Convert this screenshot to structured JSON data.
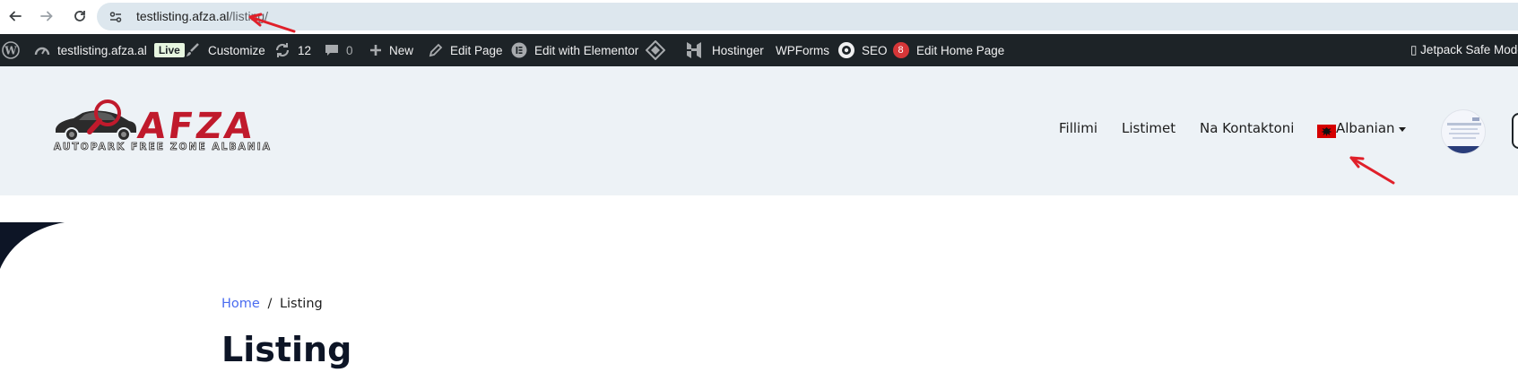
{
  "browser": {
    "url_host": "testlisting.afza.al",
    "url_path": "/listing/"
  },
  "admin_bar": {
    "site_name": "testlisting.afza.al",
    "live_badge": "Live",
    "customize": "Customize",
    "updates_count": "12",
    "comments_count": "0",
    "new": "New",
    "edit_page": "Edit Page",
    "edit_elementor": "Edit with Elementor",
    "hostinger": "Hostinger",
    "wpforms": "WPForms",
    "seo": "SEO",
    "seo_count": "8",
    "edit_home": "Edit Home Page",
    "jetpack": "▯ Jetpack Safe Mode"
  },
  "header": {
    "logo_word": "AFZA",
    "logo_tagline": "AUTOPARK FREE ZONE ALBANIA",
    "nav": [
      "Fillimi",
      "Listimet",
      "Na Kontaktoni"
    ],
    "language": "Albanian"
  },
  "content": {
    "breadcrumb_home": "Home",
    "breadcrumb_sep": "/",
    "breadcrumb_current": "Listing",
    "title": "Listing"
  },
  "colors": {
    "accent_red": "#c01a2c",
    "admin_bar_bg": "#1d2327",
    "header_bg": "#edf2f6",
    "link_blue": "#4a6cf0"
  },
  "icons": [
    "back-icon",
    "forward-icon",
    "reload-icon",
    "site-info-icon",
    "wordpress-icon",
    "dashboard-icon",
    "brush-icon",
    "updates-icon",
    "comment-icon",
    "plus-icon",
    "pencil-icon",
    "elementor-icon",
    "diamond-icon",
    "hostinger-icon",
    "seo-gear-icon",
    "albania-flag-icon",
    "caret-down-icon",
    "avatar"
  ]
}
